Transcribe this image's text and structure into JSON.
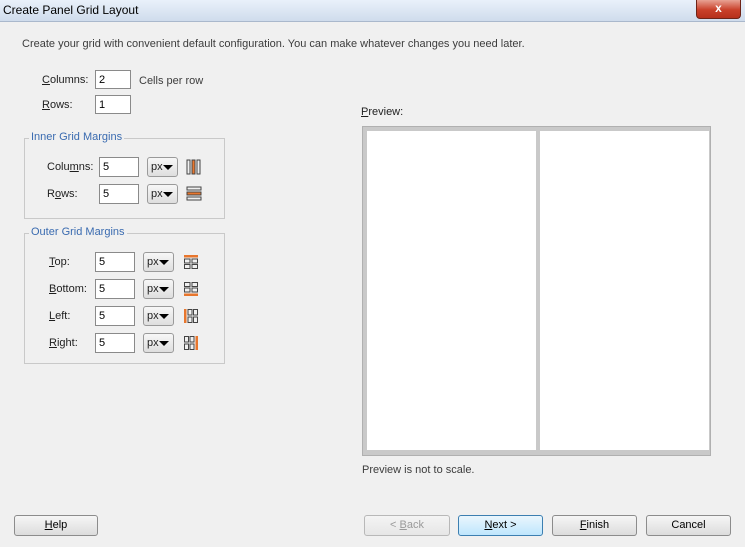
{
  "window": {
    "title": "Create Panel Grid Layout",
    "close_label": "x"
  },
  "hint": "Create your grid with convenient default configuration. You can make whatever changes you need later.",
  "grid": {
    "columns_label_u": "C",
    "columns_label_rest": "olumns:",
    "columns_value": "2",
    "columns_suffix": "Cells per row",
    "rows_label_u": "R",
    "rows_label_rest": "ows:",
    "rows_value": "1"
  },
  "inner": {
    "title": "Inner Grid Margins",
    "columns_label_pre": "Colu",
    "columns_label_u": "m",
    "columns_label_post": "ns:",
    "columns_value": "5",
    "columns_unit": "px",
    "rows_label_pre": "R",
    "rows_label_u": "o",
    "rows_label_post": "ws:",
    "rows_value": "5",
    "rows_unit": "px"
  },
  "outer": {
    "title": "Outer Grid Margins",
    "top_u": "T",
    "top_rest": "op:",
    "top_value": "5",
    "top_unit": "px",
    "bottom_u": "B",
    "bottom_rest": "ottom:",
    "bottom_value": "5",
    "bottom_unit": "px",
    "left_u": "L",
    "left_rest": "eft:",
    "left_value": "5",
    "left_unit": "px",
    "right_u": "R",
    "right_rest": "ight:",
    "right_value": "5",
    "right_unit": "px"
  },
  "preview": {
    "label_u": "P",
    "label_rest": "review:",
    "note": "Preview is not to scale."
  },
  "buttons": {
    "help_u": "H",
    "help_rest": "elp",
    "back_pre": "< ",
    "back_u": "B",
    "back_rest": "ack",
    "next_u": "N",
    "next_rest": "ext >",
    "finish_u": "F",
    "finish_rest": "inish",
    "cancel": "Cancel"
  },
  "icons": {
    "inner_columns": "column-margins-icon",
    "inner_rows": "row-margins-icon",
    "top": "top-margin-icon",
    "bottom": "bottom-margin-icon",
    "left": "left-margin-icon",
    "right": "right-margin-icon"
  },
  "colors": {
    "accent": "#e8762d",
    "group_title": "#3a6bb0"
  }
}
